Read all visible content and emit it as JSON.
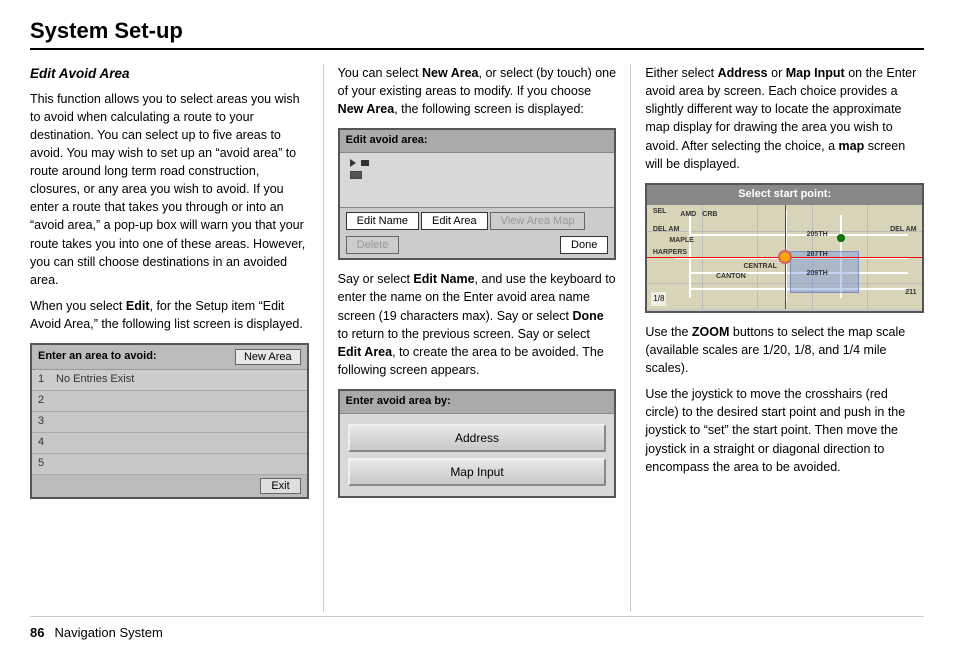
{
  "page": {
    "title": "System Set-up",
    "footer": {
      "page_number": "86",
      "nav_system_label": "Navigation System"
    }
  },
  "col1": {
    "section_title": "Edit Avoid Area",
    "paragraphs": [
      "This function allows you to select areas you wish to avoid when calculating a route to your destination. You can select up to five areas to avoid. You may wish to set up an “avoid area” to route around long term road construction, closures, or any area you wish to avoid. If you enter a route that takes you through or into an “avoid area,” a pop-up box will warn you that your route takes you into one of these areas. However, you can still choose destinations in an avoided area.",
      "When you select Edit, for the Setup item “Edit Avoid Area,” the following list screen is displayed."
    ],
    "screen1": {
      "title": "Enter an area to avoid:",
      "new_area_btn": "New Area",
      "rows": [
        {
          "num": "1",
          "text": "No Entries Exist"
        },
        {
          "num": "2",
          "text": ""
        },
        {
          "num": "3",
          "text": ""
        },
        {
          "num": "4",
          "text": ""
        },
        {
          "num": "5",
          "text": ""
        }
      ],
      "exit_btn": "Exit"
    }
  },
  "col2": {
    "intro_text": "You can select New Area, or select (by touch) one of your existing areas to modify. If you choose New Area, the following screen is displayed:",
    "screen2": {
      "title": "Edit avoid area:",
      "buttons": [
        "Edit Name",
        "Edit Area",
        "View Area Map",
        "Delete",
        "Done"
      ]
    },
    "para2": "Say or select Edit Name, and use the keyboard to enter the name on the Enter avoid area name screen (19 characters max). Say or select Done to return to the previous screen. Say or select Edit Area, to create the area to be avoided. The following screen appears.",
    "screen3": {
      "title": "Enter avoid area by:",
      "options": [
        "Address",
        "Map Input"
      ]
    }
  },
  "col3": {
    "para1": "Either select Address or Map Input on the Enter avoid area by screen. Each choice provides a slightly different way to locate the approximate map display for drawing the area you wish to avoid. After selecting the choice, a map screen will be displayed.",
    "map_screen": {
      "title": "Select start point:",
      "corner_labels": [
        "DEL AM",
        "DEL AM",
        "205TH",
        "207TH",
        "209TH",
        "211"
      ]
    },
    "para2": "Use the ZOOM buttons to select the map scale (available scales are 1/20, 1/8, and 1/4 mile scales).",
    "para3": "Use the joystick to move the crosshairs (red circle) to the desired start point and push in the joystick to “set” the start point. Then move the joystick in a straight or diagonal direction to encompass the area to be avoided."
  }
}
